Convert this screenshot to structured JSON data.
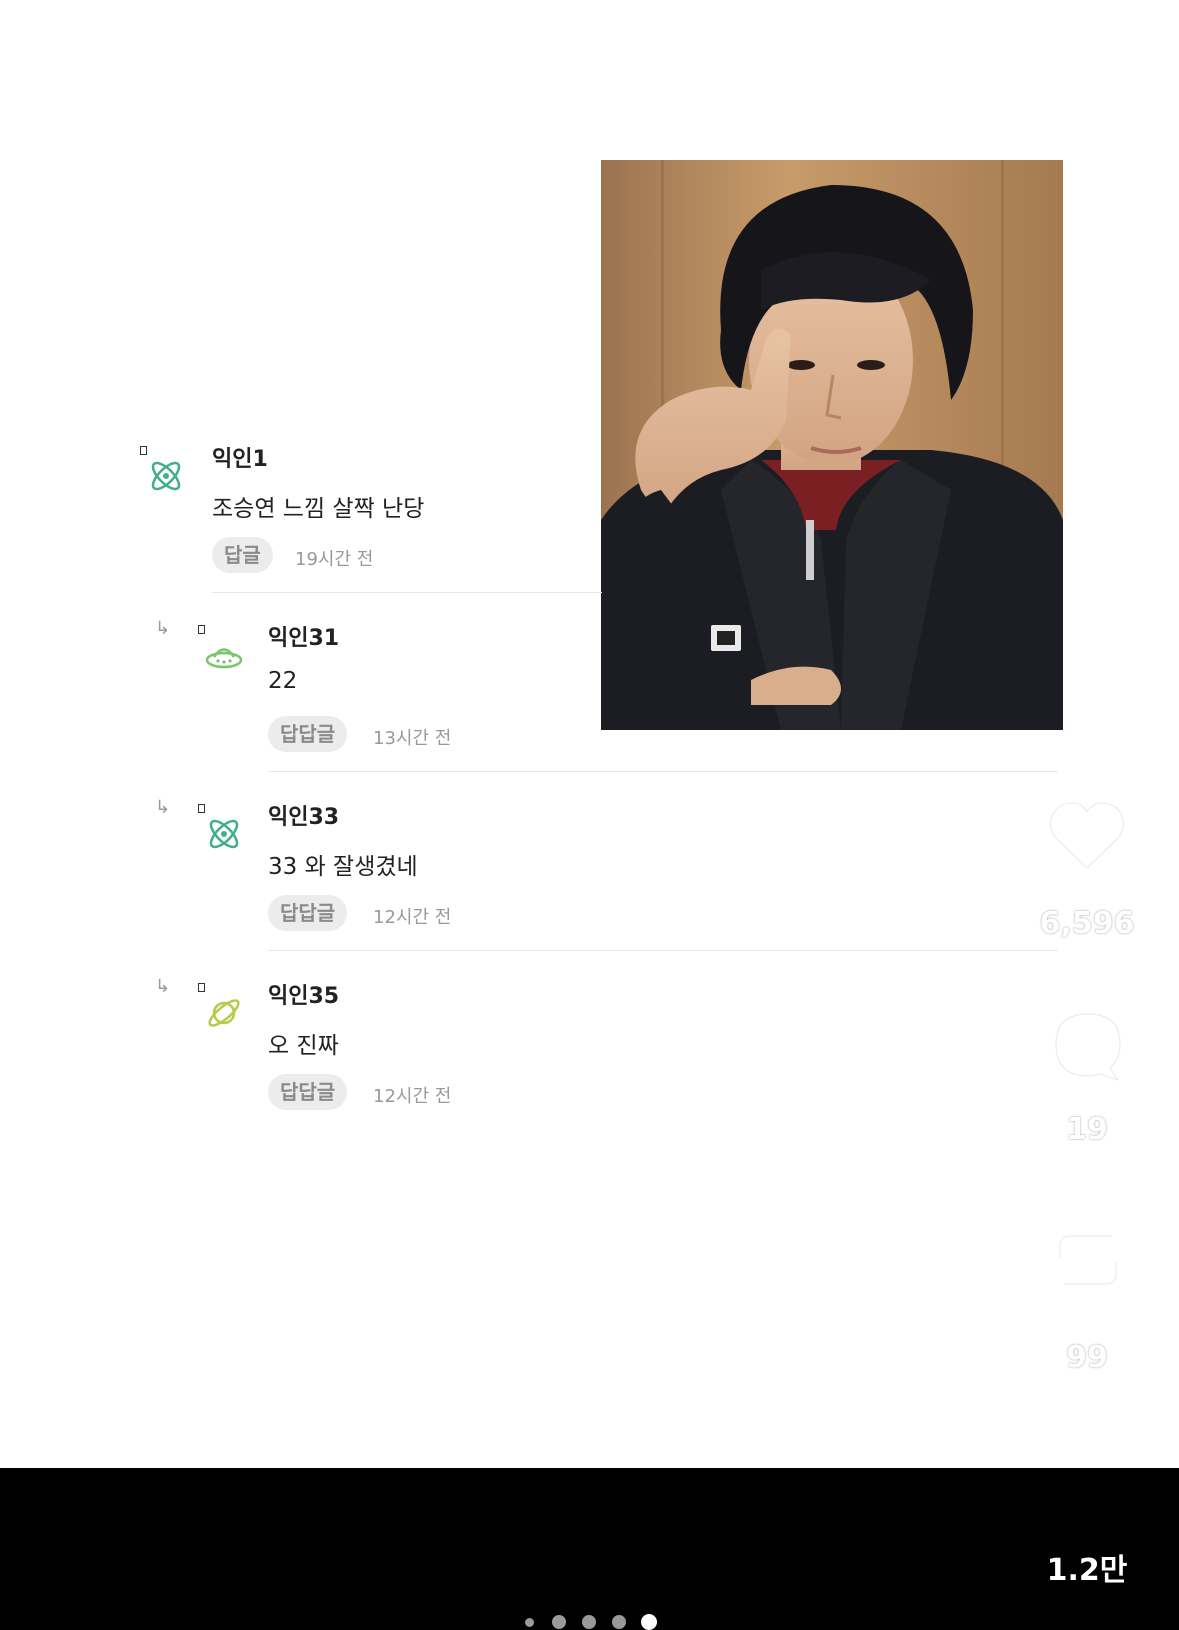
{
  "comments": [
    {
      "author": "익인1",
      "text": "조승연 느낌 살짝 난당",
      "reply_label": "답글",
      "time": "19시간 전",
      "icon": "atom-icon"
    },
    {
      "author": "익인31",
      "text": "22",
      "reply_label": "답답글",
      "time": "13시간 전",
      "icon": "ufo-icon"
    },
    {
      "author": "익인33",
      "text": "33 와 잘생겼네",
      "reply_label": "답답글",
      "time": "12시간 전",
      "icon": "atom-icon"
    },
    {
      "author": "익인35",
      "text": "오 진짜",
      "reply_label": "답답글",
      "time": "12시간 전",
      "icon": "planet-icon"
    }
  ],
  "rail": {
    "likes": "6,596",
    "comments": "19",
    "reposts": "99",
    "shares": "1.2만"
  },
  "carousel": {
    "total": 5,
    "active_index": 4
  },
  "colors": {
    "atom": "#3fae8a",
    "ufo": "#7cc46d",
    "planet": "#b9c94a"
  }
}
